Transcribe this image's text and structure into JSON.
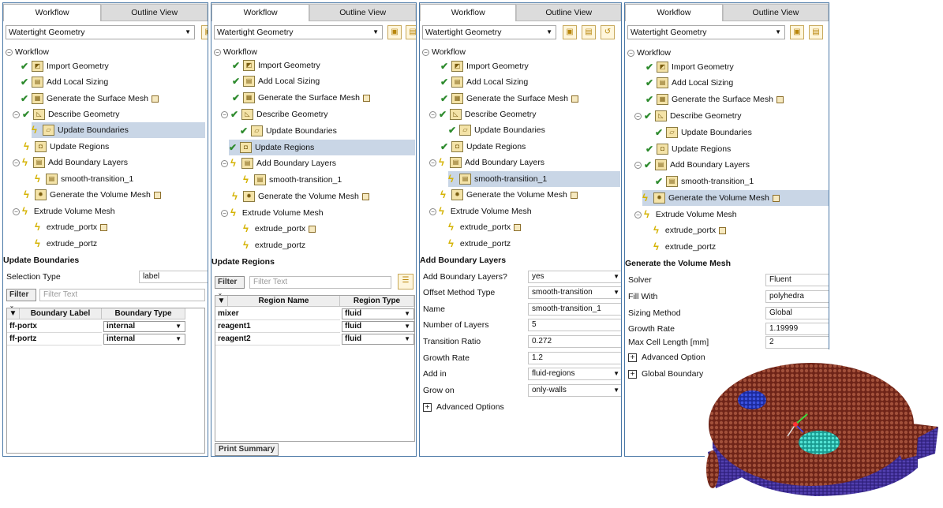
{
  "common": {
    "tab_workflow": "Workflow",
    "tab_outline": "Outline View",
    "workflow_type": "Watertight Geometry",
    "root": "Workflow",
    "nodes": {
      "import": "Import Geometry",
      "sizing": "Add Local Sizing",
      "surface": "Generate the Surface Mesh",
      "describe": "Describe Geometry",
      "boundaries": "Update Boundaries",
      "regions": "Update Regions",
      "layers": "Add Boundary Layers",
      "smooth": "smooth-transition_1",
      "volume": "Generate the Volume Mesh",
      "extrude": "Extrude Volume Mesh",
      "portx": "extrude_portx",
      "portz": "extrude_portz"
    }
  },
  "panel1": {
    "title": "Update Boundaries",
    "selection_type_label": "Selection Type",
    "selection_type_value": "label",
    "filter_button": "Filter",
    "filter_placeholder": "Filter Text",
    "col_label": "Boundary Label",
    "col_type": "Boundary Type",
    "rows": [
      {
        "label": "ff-portx",
        "type": "internal"
      },
      {
        "label": "ff-portz",
        "type": "internal"
      }
    ]
  },
  "panel2": {
    "title": "Update Regions",
    "filter_button": "Filter",
    "filter_placeholder": "Filter Text",
    "col_name": "Region Name",
    "col_type": "Region Type",
    "rows": [
      {
        "name": "mixer",
        "type": "fluid"
      },
      {
        "name": "reagent1",
        "type": "fluid"
      },
      {
        "name": "reagent2",
        "type": "fluid"
      }
    ],
    "print_summary": "Print Summary"
  },
  "panel3": {
    "title": "Add Boundary Layers",
    "fields": [
      {
        "label": "Add Boundary Layers?",
        "value": "yes"
      },
      {
        "label": "Offset Method Type",
        "value": "smooth-transition"
      },
      {
        "label": "Name",
        "value": "smooth-transition_1"
      },
      {
        "label": "Number of Layers",
        "value": "5"
      },
      {
        "label": "Transition Ratio",
        "value": "0.272"
      },
      {
        "label": "Growth Rate",
        "value": "1.2"
      },
      {
        "label": "Add in",
        "value": "fluid-regions"
      },
      {
        "label": "Grow on",
        "value": "only-walls"
      }
    ],
    "advanced": "Advanced Options"
  },
  "panel4": {
    "title": "Generate the Volume Mesh",
    "fields": [
      {
        "label": "Solver",
        "value": "Fluent"
      },
      {
        "label": "Fill With",
        "value": "polyhedra"
      },
      {
        "label": "Sizing Method",
        "value": "Global"
      },
      {
        "label": "Growth Rate",
        "value": "1.19999"
      },
      {
        "label": "Max Cell Length [mm]",
        "value": "2"
      }
    ],
    "advanced": "Advanced Options",
    "global_bl": "Global Boundary La"
  },
  "colors": {
    "selection": "#c9d6e6",
    "mesh_body": "#7a2a1e",
    "mesh_base": "#3c2a8a",
    "mesh_blue": "#2e3fc8",
    "mesh_cyan": "#3fd6c8"
  }
}
